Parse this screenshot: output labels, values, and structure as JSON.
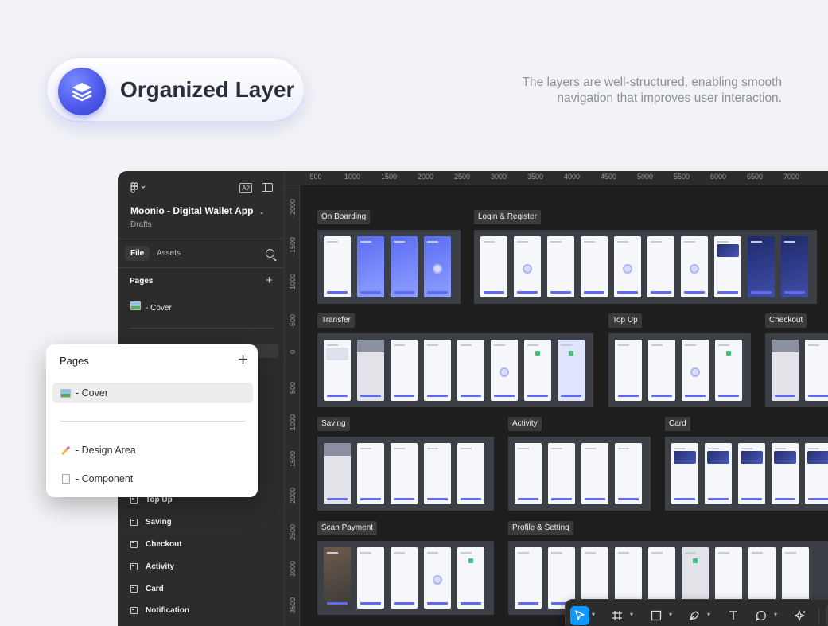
{
  "hero": {
    "title": "Organized Layer",
    "description": "The layers are well-structured, enabling smooth navigation that improves user interaction."
  },
  "sidebar": {
    "project_name": "Moonio - Digital Wallet App",
    "project_sub": "Drafts",
    "tabs": [
      "File",
      "Assets"
    ],
    "pages_title": "Pages",
    "cover_page": "- Cover",
    "layers": [
      "Top Up",
      "Saving",
      "Checkout",
      "Activity",
      "Card",
      "Notification"
    ]
  },
  "ruler": {
    "top": [
      "500",
      "1000",
      "1500",
      "2000",
      "2500",
      "3000",
      "3500",
      "4000",
      "4500",
      "5000",
      "5500",
      "6000",
      "6500",
      "7000"
    ],
    "left": [
      "-2000",
      "-1500",
      "-1000",
      "-500",
      "0",
      "500",
      "1000",
      "1500",
      "2000",
      "2500",
      "3000",
      "3500"
    ]
  },
  "canvas": {
    "sections": [
      "On Boarding",
      "Login & Register",
      "Transfer",
      "Top Up",
      "Checkout",
      "Saving",
      "Activity",
      "Card",
      "Scan Payment",
      "Profile & Setting"
    ]
  },
  "pages_panel": {
    "title": "Pages",
    "items": [
      "- Cover",
      "- Design Area",
      "- Component"
    ]
  },
  "colors": {
    "accent": "#4a56e8",
    "toolbar_active": "#0d99ff",
    "canvas_bg": "#1e1e1e"
  }
}
